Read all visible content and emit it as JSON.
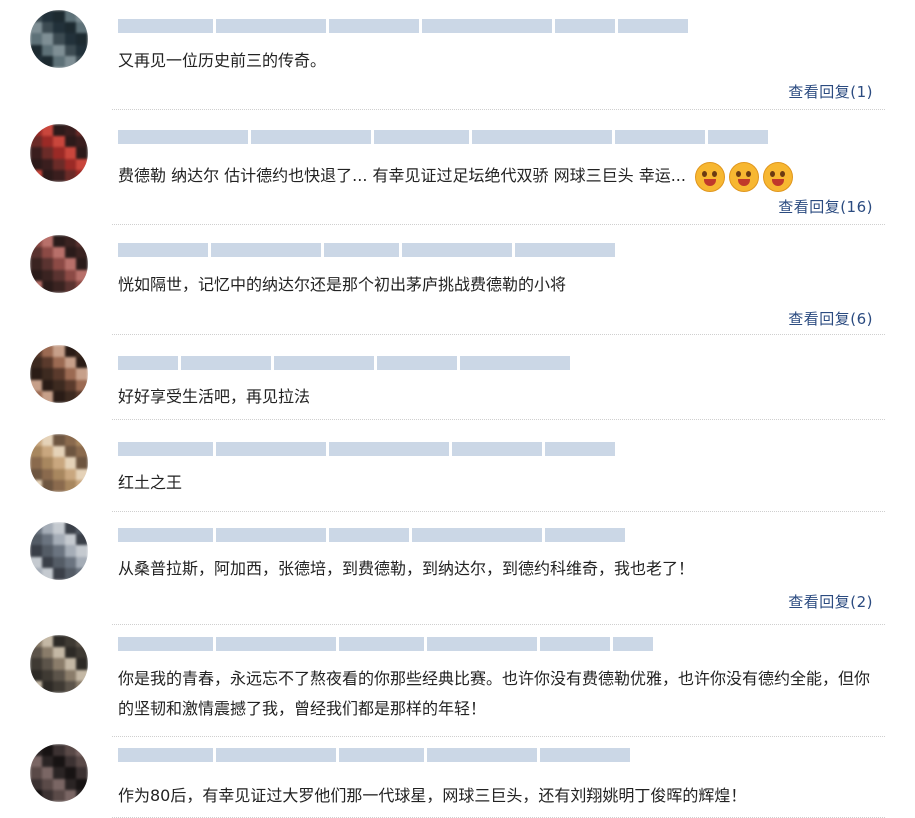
{
  "comments": [
    {
      "text": "又再见一位历史前三的传奇。",
      "reply": "查看回复(1)",
      "avatar_colors": [
        "#3c4b52",
        "#5e7178",
        "#22313a",
        "#7f8f95",
        "#1d2a30"
      ]
    },
    {
      "text": "费德勒 纳达尔 估计德约也快退了... 有幸见证过足坛绝代双骄 网球三巨头 幸运...",
      "reply": "查看回复(16)",
      "emoji_count": 3,
      "avatar_colors": [
        "#9b2a26",
        "#3a1e1e",
        "#c9463c",
        "#6b2b28",
        "#2c1a1a"
      ]
    },
    {
      "text": "恍如隔世，记忆中的纳达尔还是那个初出茅庐挑战费德勒的小将",
      "reply": "查看回复(6)",
      "avatar_colors": [
        "#8c4a45",
        "#3a2321",
        "#b8706a",
        "#5a3330",
        "#2a1b1a"
      ]
    },
    {
      "text": "好好享受生活吧，再见拉法",
      "reply": "",
      "avatar_colors": [
        "#5a3a2c",
        "#2a1c16",
        "#9b6a52",
        "#3d2a20",
        "#c7a08a"
      ]
    },
    {
      "text": "红土之王",
      "reply": "",
      "avatar_colors": [
        "#c9a77f",
        "#8a6a4d",
        "#e5d2b8",
        "#a8875f",
        "#6d5540"
      ]
    },
    {
      "text": "从桑普拉斯，阿加西，张德培，到费德勒，到纳达尔，到德约科维奇，我也老了！",
      "reply": "查看回复(2)",
      "avatar_colors": [
        "#6b7480",
        "#3a3f48",
        "#a5adb7",
        "#545c66",
        "#c5cad0"
      ]
    },
    {
      "text": "你是我的青春，永远忘不了熬夜看的你那些经典比赛。也许你没有费德勒优雅，也许你没有德约全能，但你的坚韧和激情震撼了我，曾经我们都是那样的年轻！",
      "reply": "",
      "avatar_colors": [
        "#8a7c6a",
        "#3f3a33",
        "#c4b8a5",
        "#5c544a",
        "#2d2a26"
      ]
    },
    {
      "text": "作为80后，有幸见证过大罗他们那一代球星，网球三巨头，还有刘翔姚明丁俊晖的辉煌！",
      "reply": "",
      "avatar_colors": [
        "#2a2424",
        "#5a4a48",
        "#171313",
        "#7a6664",
        "#3c3232"
      ]
    }
  ]
}
